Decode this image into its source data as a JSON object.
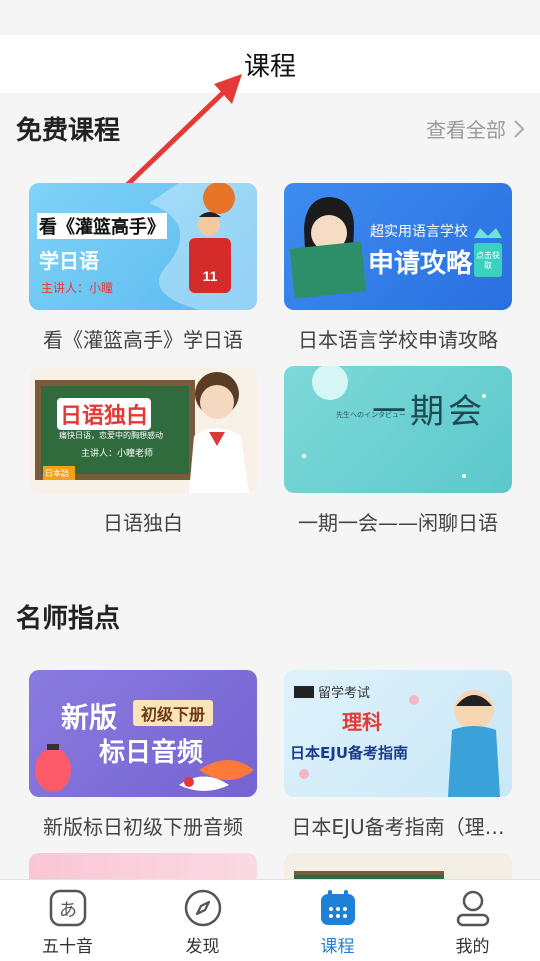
{
  "header": {
    "title": "课程"
  },
  "sections": {
    "free": {
      "title": "免费课程",
      "more_label": "查看全部",
      "courses": [
        {
          "caption": "看《灌篮高手》学日语",
          "thumb_title": "看《灌篮高手》",
          "thumb_sub": "学日语",
          "thumb_lecturer": "主讲人：小瞳"
        },
        {
          "caption": "日本语言学校申请攻略",
          "thumb_title": "超实用语言学校",
          "thumb_sub": "申请攻略",
          "thumb_badge": "点击获取"
        },
        {
          "caption": "日语独白",
          "thumb_title": "日语独白",
          "thumb_sub": "痛快日语，恋爱中的胸想感动",
          "thumb_lecturer": "主讲人：小瞳老师",
          "thumb_tag": "日本語"
        },
        {
          "caption": "一期一会——闲聊日语",
          "thumb_title": "一期会",
          "thumb_sub": "先生へのインタビュー"
        }
      ]
    },
    "teacher": {
      "title": "名师指点",
      "courses": [
        {
          "caption": "新版标日初级下册音频",
          "thumb_title": "新版",
          "thumb_sub": "标日音频",
          "thumb_badge": "初级下册"
        },
        {
          "caption": "日本EJU备考指南（理…",
          "thumb_title": "留学考试",
          "thumb_sub": "理科",
          "thumb_extra": "日本EJU备考指南"
        }
      ]
    }
  },
  "tabs": [
    {
      "label": "五十音",
      "icon": "kana-icon"
    },
    {
      "label": "发现",
      "icon": "compass-icon"
    },
    {
      "label": "课程",
      "icon": "calendar-icon",
      "active": true
    },
    {
      "label": "我的",
      "icon": "user-icon"
    }
  ],
  "colors": {
    "accent": "#1e80d7",
    "arrow": "#e53935"
  }
}
